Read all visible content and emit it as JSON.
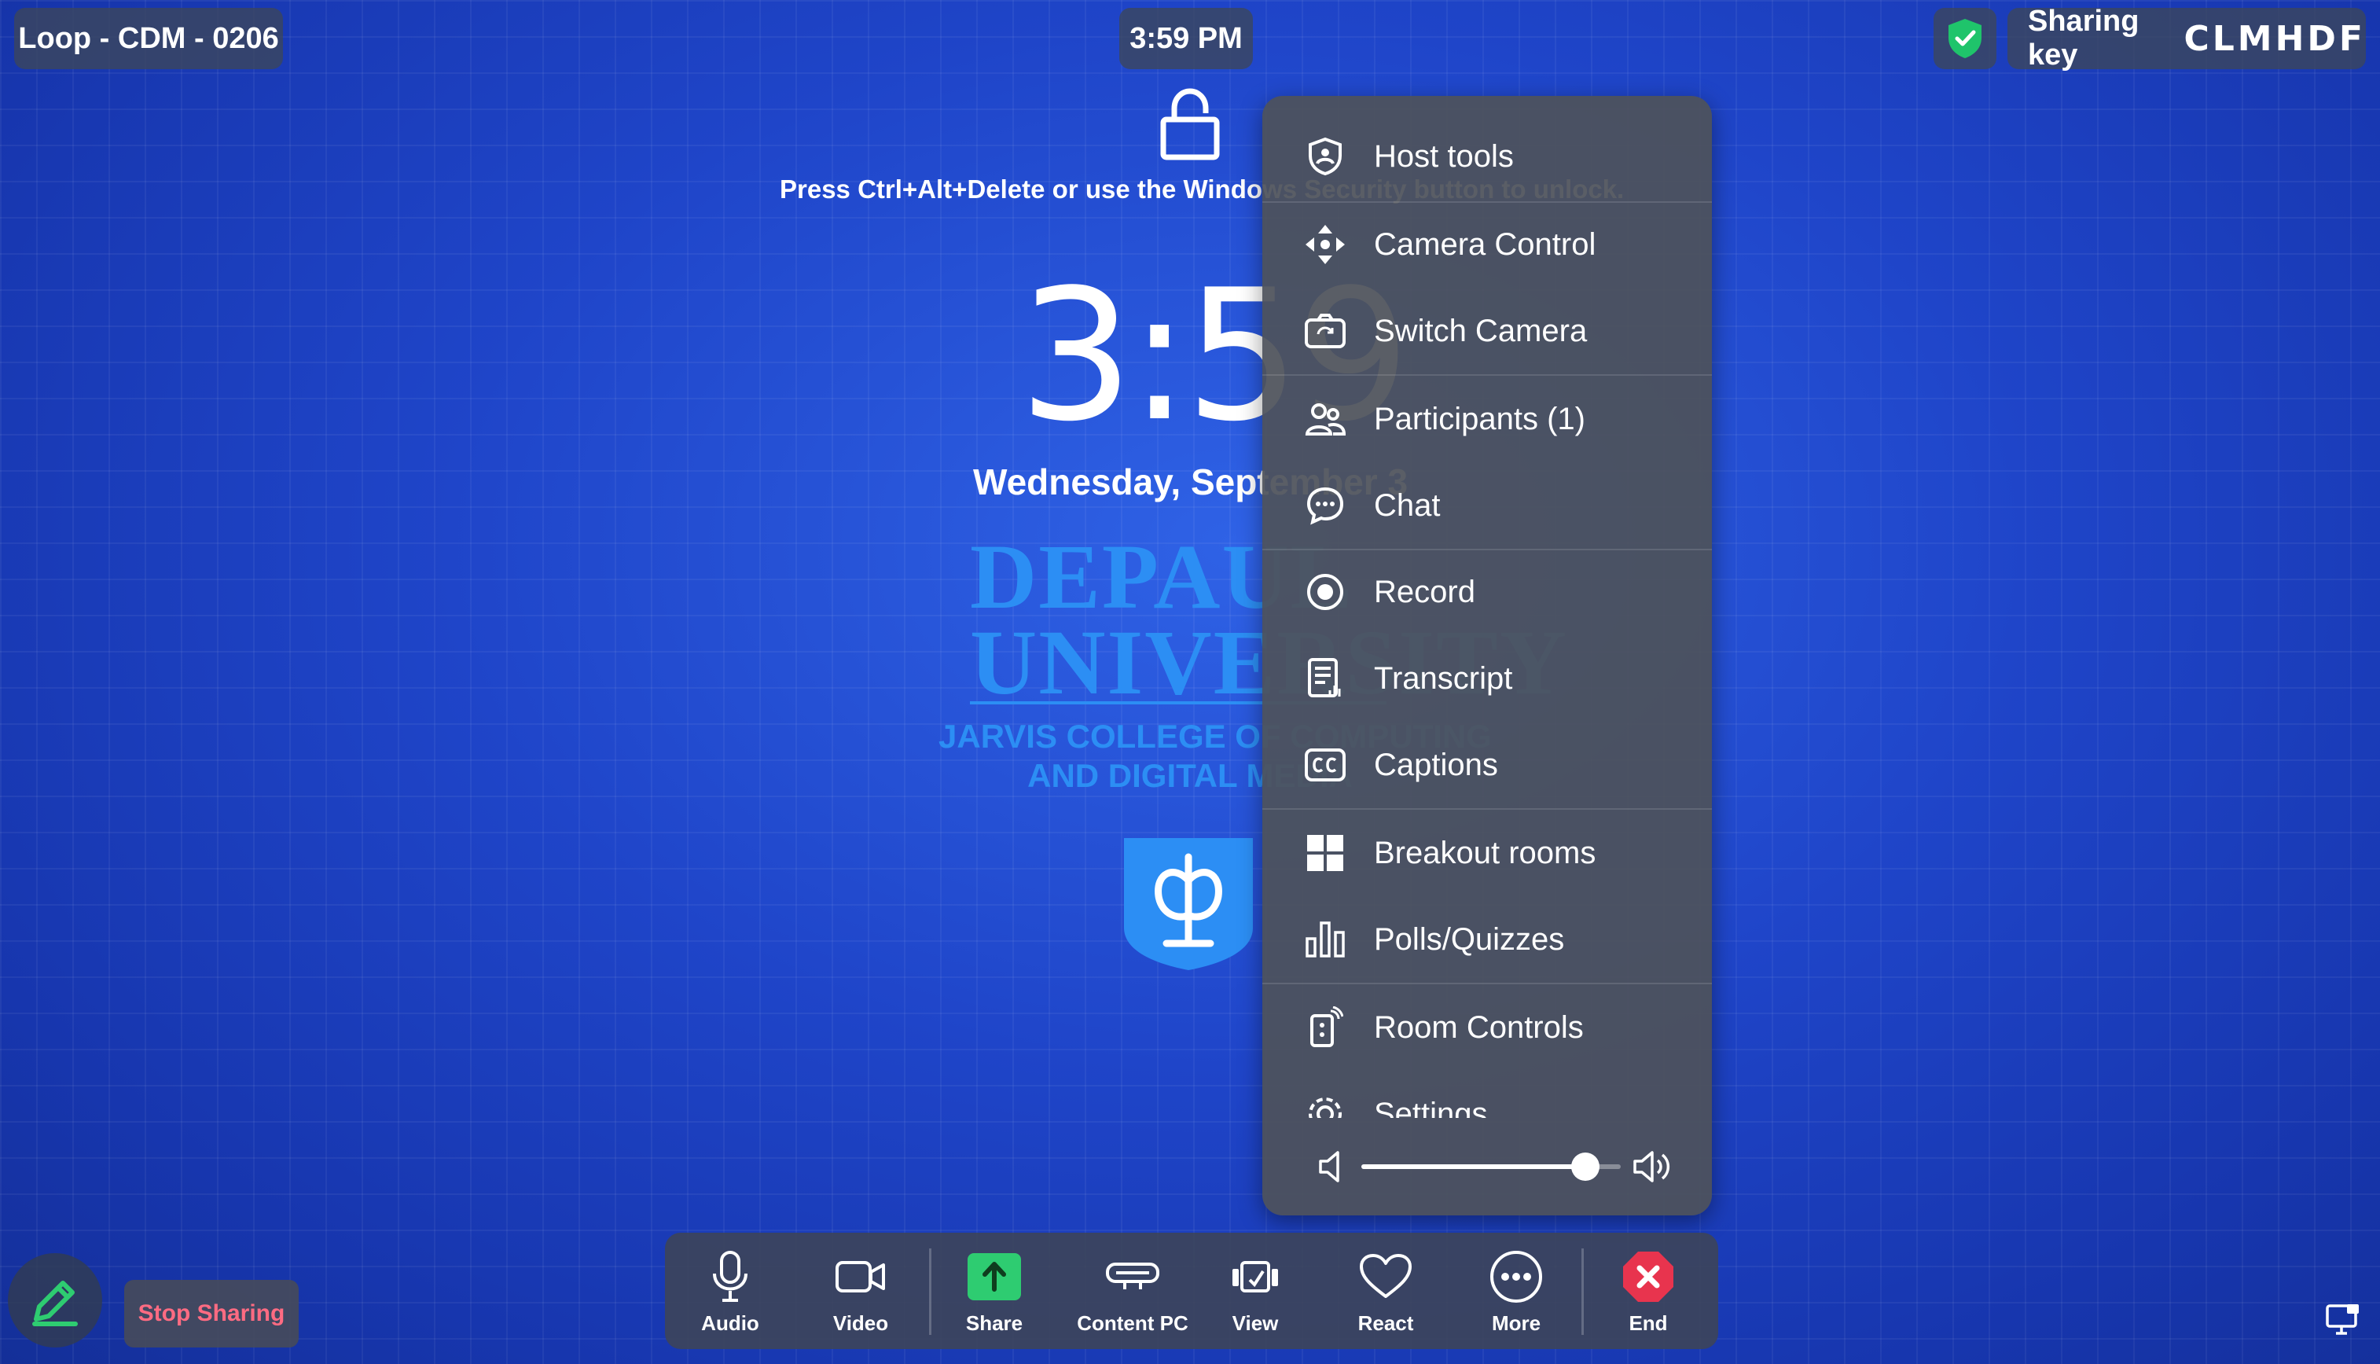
{
  "header": {
    "room_name": "Loop - CDM - 0206",
    "time": "3:59 PM",
    "sharing_key_label": "Sharing key",
    "sharing_key_value": "CLMHDF"
  },
  "lock_screen": {
    "unlock_hint": "Press Ctrl+Alt+Delete or use the Windows Security button to unlock.",
    "clock": "3:59",
    "date": "Wednesday, September 3"
  },
  "logo": {
    "line1": "DEPAUL",
    "line2": "UNIVERSITY",
    "sub1": "JARVIS COLLEGE OF COMPUTING",
    "sub2": "AND DIGITAL MEDIA"
  },
  "more_menu": {
    "items": [
      {
        "label": "Host tools",
        "icon": "shield-icon"
      },
      {
        "label": "Camera Control",
        "icon": "move-arrows-icon"
      },
      {
        "label": "Switch Camera",
        "icon": "switch-camera-icon"
      },
      {
        "label": "Participants (1)",
        "icon": "participants-icon"
      },
      {
        "label": "Chat",
        "icon": "chat-icon"
      },
      {
        "label": "Record",
        "icon": "record-icon"
      },
      {
        "label": "Transcript",
        "icon": "transcript-icon"
      },
      {
        "label": "Captions",
        "icon": "captions-icon"
      },
      {
        "label": "Breakout rooms",
        "icon": "breakout-rooms-icon"
      },
      {
        "label": "Polls/Quizzes",
        "icon": "polls-icon"
      },
      {
        "label": "Room Controls",
        "icon": "room-controls-icon"
      },
      {
        "label": "Settings",
        "icon": "settings-icon"
      }
    ],
    "volume_level": 0.9
  },
  "toolbar": {
    "audio": "Audio",
    "video": "Video",
    "share": "Share",
    "content_pc": "Content PC",
    "view": "View",
    "react": "React",
    "more": "More",
    "end": "End"
  },
  "bottom": {
    "stop_sharing": "Stop Sharing"
  },
  "colors": {
    "share_green": "#2ecc71",
    "end_red": "#e8344e",
    "stop_text": "#ff6b82",
    "brand_blue": "#2c8ef4"
  }
}
